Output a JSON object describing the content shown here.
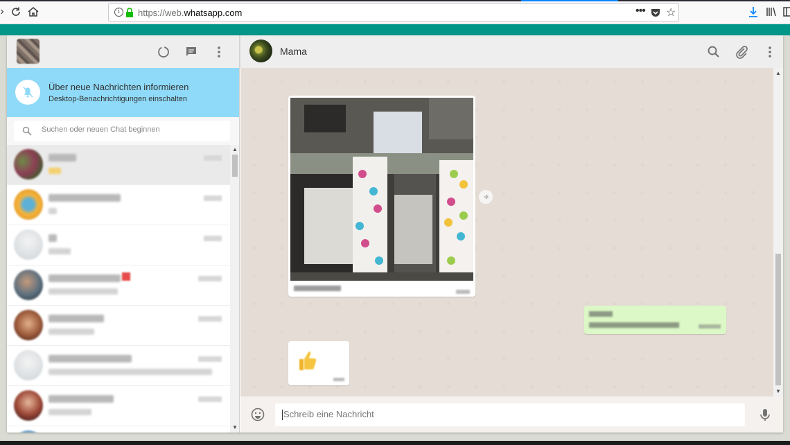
{
  "browser": {
    "url_prefix": "https://web.",
    "url_domain": "whatsapp.com",
    "more_label": "•••"
  },
  "sidebar": {
    "notification": {
      "title": "Über neue Nachrichten informieren",
      "subtitle": "Desktop-Benachrichtigungen einschalten"
    },
    "search": {
      "placeholder": "Suchen oder neuen Chat beginnen"
    }
  },
  "chat": {
    "contact_name": "Mama",
    "compose_placeholder": "Schreib eine Nachricht"
  },
  "colors": {
    "teal": "#009688",
    "notify_bg": "#8fdaf8",
    "outgoing_bubble": "#dcf8c6",
    "conversation_bg": "#e5ddd5"
  }
}
